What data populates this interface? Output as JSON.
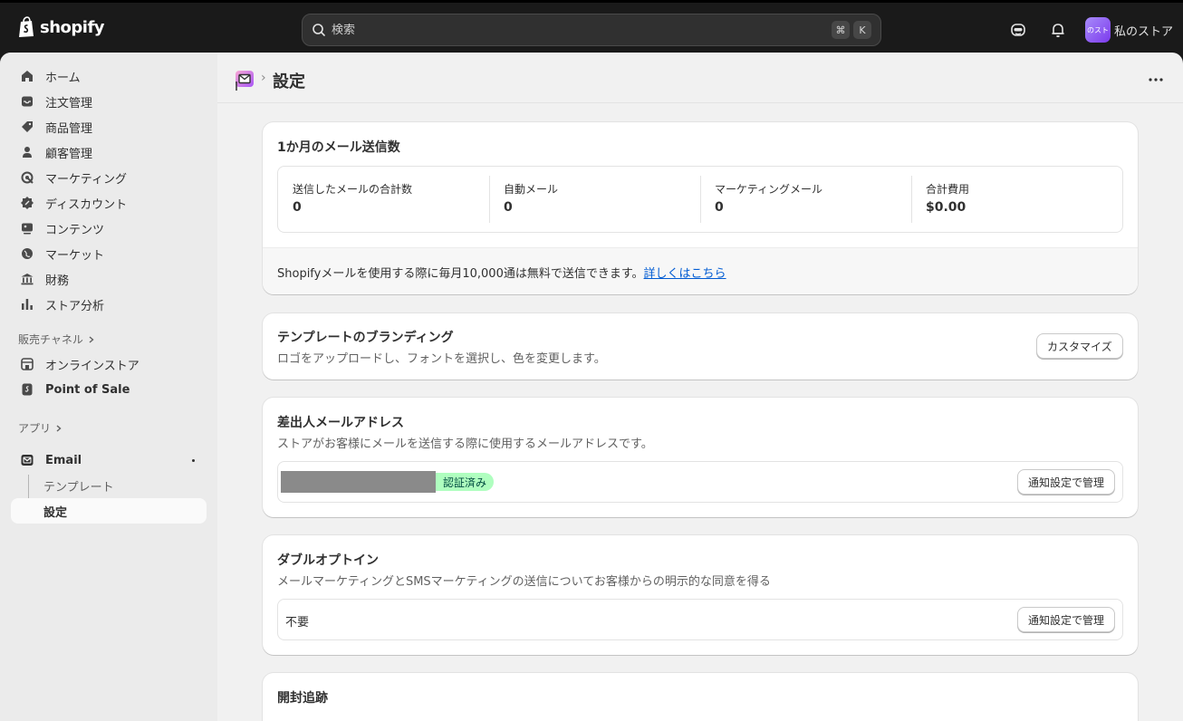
{
  "topbar": {
    "brand": "shopify",
    "search_placeholder": "検索",
    "shortcut_keys": [
      "⌘",
      "K"
    ],
    "avatar_text": "のスト",
    "store_name": "私のストア"
  },
  "sidebar": {
    "items": [
      {
        "label": "ホーム",
        "icon": "home-icon"
      },
      {
        "label": "注文管理",
        "icon": "inbox-icon"
      },
      {
        "label": "商品管理",
        "icon": "tag-icon"
      },
      {
        "label": "顧客管理",
        "icon": "person-icon"
      },
      {
        "label": "マーケティング",
        "icon": "target-icon"
      },
      {
        "label": "ディスカウント",
        "icon": "discount-icon"
      },
      {
        "label": "コンテンツ",
        "icon": "content-icon"
      },
      {
        "label": "マーケット",
        "icon": "globe-icon"
      },
      {
        "label": "財務",
        "icon": "bank-icon"
      },
      {
        "label": "ストア分析",
        "icon": "chart-icon"
      }
    ],
    "sales_channels_label": "販売チャネル",
    "channels": [
      {
        "label": "オンラインストア",
        "icon": "store-icon"
      },
      {
        "label": "Point of Sale",
        "icon": "pos-icon"
      }
    ],
    "apps_label": "アプリ",
    "app": {
      "label": "Email",
      "sub_items": [
        "テンプレート",
        "設定"
      ]
    }
  },
  "header": {
    "separator": "›",
    "title": "設定"
  },
  "usage_card": {
    "title": "1か月のメール送信数",
    "stats": [
      {
        "label": "送信したメールの合計数",
        "value": "0"
      },
      {
        "label": "自動メール",
        "value": "0"
      },
      {
        "label": "マーケティングメール",
        "value": "0"
      },
      {
        "label": "合計費用",
        "value": "$0.00"
      }
    ],
    "footer_text": "Shopifyメールを使用する際に毎月10,000通は無料で送信できます。",
    "footer_link": "詳しくはこちら"
  },
  "branding_card": {
    "title": "テンプレートのブランディング",
    "subtitle": "ロゴをアップロードし、フォントを選択し、色を変更します。",
    "button": "カスタマイズ"
  },
  "sender_card": {
    "title": "差出人メールアドレス",
    "subtitle": "ストアがお客様にメールを送信する際に使用するメールアドレスです。",
    "badge": "認証済み",
    "button": "通知設定で管理"
  },
  "optin_card": {
    "title": "ダブルオプトイン",
    "subtitle": "メールマーケティングとSMSマーケティングの送信についてお客様からの明示的な同意を得る",
    "value": "不要",
    "button": "通知設定で管理"
  },
  "tracking_card": {
    "title": "開封追跡"
  }
}
